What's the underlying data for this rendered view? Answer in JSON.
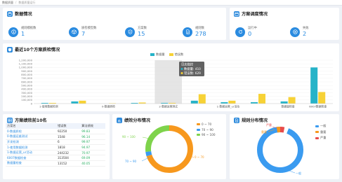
{
  "breadcrumb": {
    "home": "数据质量",
    "separator": "/",
    "current": "数据质量运行"
  },
  "data_overview": {
    "title": "数据情况",
    "stats": [
      {
        "label": "规则模板数",
        "value": "1"
      },
      {
        "label": "质检模型数",
        "value": "7"
      },
      {
        "label": "方案数",
        "value": "15"
      },
      {
        "label": "规则数",
        "value": "278"
      }
    ]
  },
  "schedule": {
    "title": "方案调度情况",
    "stats": [
      {
        "label": "运行中",
        "value": "0"
      },
      {
        "label": "失败",
        "value": "2"
      }
    ]
  },
  "recent": {
    "title": "最近10个方案质检情况",
    "tooltip": {
      "title": "日志临控",
      "line1": "数据量: 410",
      "line2": "错误数: 629"
    },
    "colors": {
      "data": "#26b3c8",
      "error": "#f7d236"
    }
  },
  "chart_data": {
    "type": "bar",
    "legend": [
      "数据量",
      "错误数"
    ],
    "categories": [
      "1-使用数据检测",
      "",
      "0-数据质检",
      "",
      "2-数据运营测试",
      "",
      "1-数据运营_ur活动",
      "",
      "数据量检查",
      "6007数据检查"
    ],
    "x_tick_labels": [
      "1-使用数据检测",
      "0-数据质检",
      "2-数据运营测试",
      "1-数据运营_ur活动",
      "数据量检查",
      "6007数据检查"
    ],
    "series": [
      {
        "name": "数据量",
        "values": [
          20000,
          60000,
          0,
          20000,
          20000,
          80000,
          40000,
          40000,
          60000,
          1000000
        ]
      },
      {
        "name": "错误数",
        "values": [
          20000,
          80000,
          10000,
          30000,
          20000,
          260000,
          80000,
          270000,
          180000,
          320000
        ]
      }
    ],
    "ylim": [
      0,
      1200000
    ],
    "y_ticks": [
      "0",
      "100,000",
      "200,000",
      "300,000",
      "400,000",
      "500,000",
      "600,000",
      "700,000",
      "800,000",
      "900,000",
      "1,000,000",
      "1,100,000",
      "1,200,000"
    ],
    "highlight_category_index": 4,
    "grid": true,
    "legend_position": "top-right"
  },
  "ranking": {
    "title": "方案绩效前10名",
    "columns": [
      "方案名",
      "错误数",
      "算法绩效"
    ],
    "rows": [
      [
        "0-数据质检",
        "92250",
        "99.83"
      ],
      [
        "0-数据运维测试",
        "1548",
        "96.14"
      ],
      [
        "开发检测",
        "6",
        "99.97"
      ],
      [
        "1-使用数据检测",
        "1818",
        "94.97"
      ],
      [
        "1-数据运营_ur活动",
        "244232",
        "70.97"
      ],
      [
        "6007数据检查",
        "313504",
        "69.09"
      ],
      [
        "数据量检查",
        "13152",
        "40.05"
      ]
    ]
  },
  "performance": {
    "title": "绩效分布情况",
    "legend": [
      {
        "label": "0 ~ 70",
        "color": "#f7981d"
      },
      {
        "label": "70 ~ 90",
        "color": "#3a9bf0"
      },
      {
        "label": "90 ~ 100",
        "color": "#7ed34b"
      }
    ],
    "labels": {
      "a": "0 ~ 70",
      "b": "70 ~ 90",
      "c": "90 ~ 100"
    },
    "slices": [
      0.7,
      0.03,
      0.27
    ]
  },
  "rules": {
    "title": "规则分布情况",
    "legend": [
      {
        "label": "一般",
        "color": "#3a9bf0"
      },
      {
        "label": "重要",
        "color": "#f7981d"
      },
      {
        "label": "严重",
        "color": "#e84b4b"
      }
    ],
    "labels": {
      "a": "一般",
      "b": "重要",
      "c": "严重"
    },
    "slices": [
      0.94,
      0.03,
      0.03
    ]
  }
}
